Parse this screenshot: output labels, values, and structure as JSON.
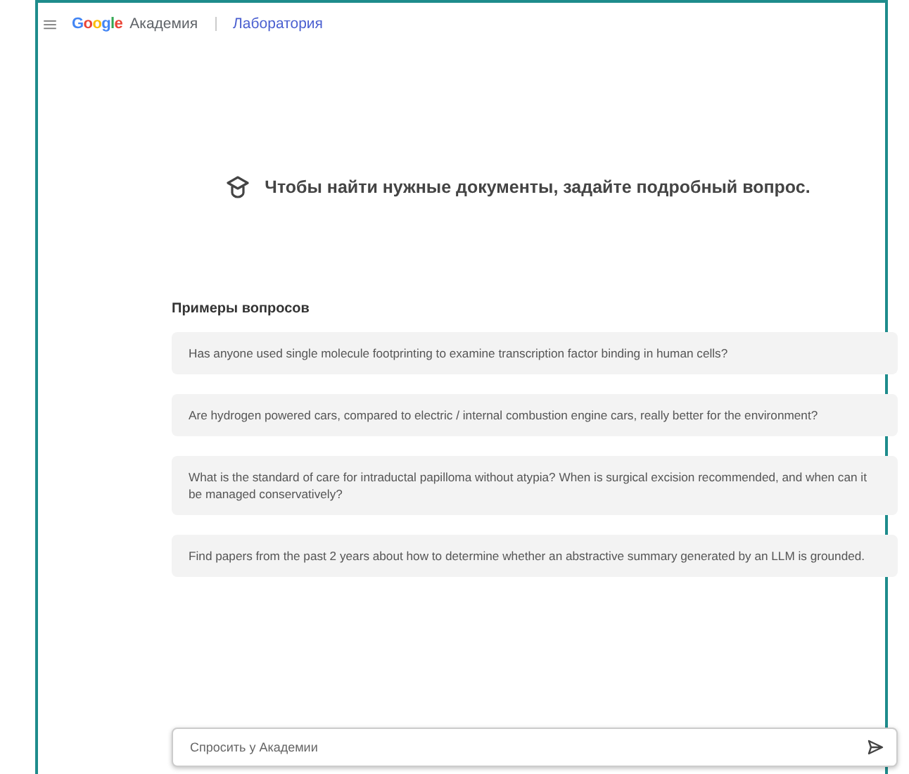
{
  "header": {
    "logo": "Google",
    "product": "Академия",
    "section": "Лаборатория"
  },
  "prompt": "Чтобы найти нужные документы, задайте подробный вопрос.",
  "examples": {
    "title": "Примеры вопросов",
    "items": [
      "Has anyone used single molecule footprinting to examine transcription factor binding in human cells?",
      "Are hydrogen powered cars, compared to electric / internal combustion engine cars, really better for the environment?",
      "What is the standard of care for intraductal papilloma without atypia? When is surgical excision recommended, and when can it be managed conservatively?",
      "Find papers from the past 2 years about how to determine whether an abstractive summary generated by an LLM is grounded."
    ]
  },
  "search": {
    "placeholder": "Спросить у Академии"
  }
}
